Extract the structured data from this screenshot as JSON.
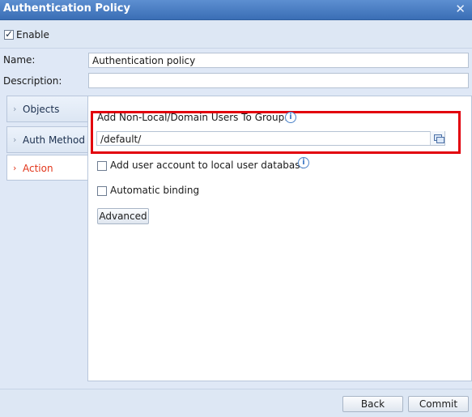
{
  "window": {
    "title": "Authentication Policy"
  },
  "enable": {
    "label": "Enable",
    "checked": true
  },
  "form": {
    "name_label": "Name:",
    "name_value": "Authentication policy",
    "description_label": "Description:",
    "description_value": ""
  },
  "tabs": [
    {
      "label": "Objects",
      "active": false
    },
    {
      "label": "Auth Method",
      "active": false
    },
    {
      "label": "Action",
      "active": true
    }
  ],
  "action_panel": {
    "group_label": "Add Non-Local/Domain Users To Group:",
    "group_value": "/default/",
    "local_db_label": "Add user account to local user database",
    "local_db_checked": false,
    "auto_binding_label": "Automatic binding",
    "auto_binding_checked": false,
    "advanced_button": "Advanced"
  },
  "footer": {
    "back_button": "Back",
    "commit_button": "Commit"
  },
  "colors": {
    "title_bar": "#3a6eb5",
    "active_tab": "#e2361b",
    "highlight": "#e2000c"
  },
  "icons": {
    "info": "info-icon",
    "picker": "group-picker-icon",
    "close": "close-icon"
  }
}
